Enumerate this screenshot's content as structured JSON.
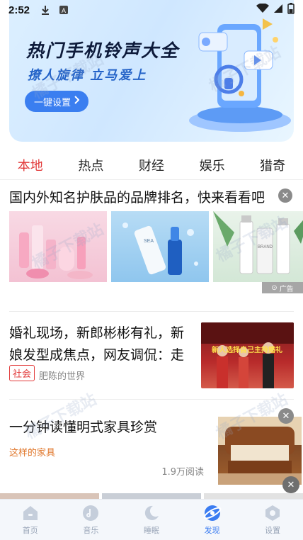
{
  "status_bar": {
    "time": "2:52"
  },
  "banner": {
    "title": "热门手机铃声大全",
    "subtitle": "撩人旋律 立马爱上",
    "button_label": "一键设置"
  },
  "tabs": [
    {
      "label": "本地",
      "active": true
    },
    {
      "label": "热点",
      "active": false
    },
    {
      "label": "财经",
      "active": false
    },
    {
      "label": "娱乐",
      "active": false
    },
    {
      "label": "猎奇",
      "active": false
    }
  ],
  "feed": {
    "ad": {
      "title": "国内外知名护肤品的品牌排名，快来看看吧",
      "badge": "广告",
      "product_label_1": "SEA",
      "product_label_2": "BRAND"
    },
    "news1": {
      "title": "婚礼现场，新郎彬彬有礼，新娘发型成焦点，网友调侃：走",
      "tag": "社会",
      "source": "肥陈的世界",
      "image_caption": "新人选择自己主持婚礼"
    },
    "news2": {
      "title": "一分钟读懂明式家具珍赏",
      "source": "这样的家具",
      "reads": "1.9万阅读"
    }
  },
  "bottom_nav": [
    {
      "label": "首页",
      "icon": "home-icon",
      "active": false
    },
    {
      "label": "音乐",
      "icon": "music-icon",
      "active": false
    },
    {
      "label": "睡眠",
      "icon": "moon-icon",
      "active": false
    },
    {
      "label": "发现",
      "icon": "planet-icon",
      "active": true
    },
    {
      "label": "设置",
      "icon": "settings-icon",
      "active": false
    }
  ],
  "watermark": "橘子下载站",
  "colors": {
    "accent_red": "#e23b3b",
    "nav_active": "#3b7cf1",
    "banner_button": "#3a7ef0",
    "source_orange": "#e0762a"
  }
}
